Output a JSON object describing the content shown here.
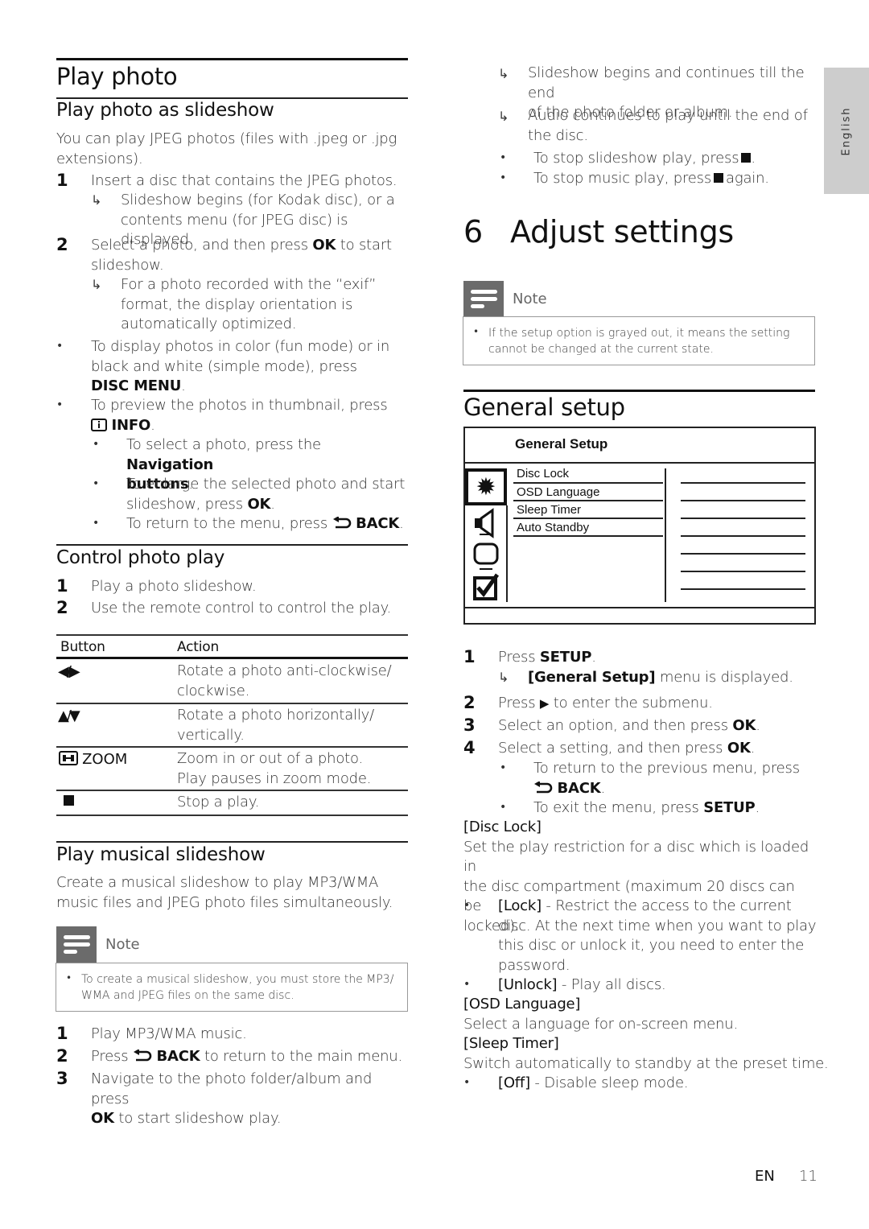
{
  "left": {
    "section_title": "Play photo",
    "slideshow": {
      "title": "Play photo as slideshow",
      "intro": "You can play JPEG photos (files with .jpeg or .jpg extensions).",
      "intro_l1": "You can play JPEG photos (files with .jpeg or .jpg",
      "intro_l2": "extensions).",
      "step1": {
        "num": "1",
        "text": "Insert a disc that contains the JPEG photos.",
        "result_l1": "Slideshow begins (for Kodak disc), or a",
        "result_l2": "contents menu (for JPEG disc) is displayed."
      },
      "step2": {
        "num": "2",
        "l1_pre": "Select a photo, and then press ",
        "l1_bold": "OK",
        "l1_post": " to start",
        "l2": "slideshow.",
        "result_l1": "For a photo recorded with the “exif”",
        "result_l2": "format, the display orientation is",
        "result_l3": "automatically optimized."
      },
      "bullet1": {
        "l1": "To display photos in color (fun mode) or in",
        "l2": "black and white (simple mode), press",
        "bold": "DISC MENU",
        "post": "."
      },
      "bullet2": {
        "l1": "To preview the photos in thumbnail, press",
        "bold": "INFO",
        "post": "."
      },
      "sub1": {
        "pre": "To select a photo, press the ",
        "bold1": "Navigation",
        "bold2": "buttons",
        "post": "."
      },
      "sub2": {
        "l1": "To enlarge the selected photo and start",
        "l2_pre": "slideshow, press ",
        "bold": "OK",
        "post": "."
      },
      "sub3": {
        "pre": "To return to the menu, press ",
        "bold": "BACK",
        "post": "."
      }
    },
    "control": {
      "title": "Control photo play",
      "step1": {
        "num": "1",
        "text": "Play a photo slideshow."
      },
      "step2": {
        "num": "2",
        "text": "Use the remote control to control the play."
      },
      "table": {
        "headers": [
          "Button",
          "Action"
        ],
        "rows": [
          {
            "button": "◀/▶",
            "icon": "left-right-arrows-icon",
            "action_l1": "Rotate a photo anti-clockwise/",
            "action_l2": "clockwise."
          },
          {
            "button": "▲/▼",
            "icon": "up-down-arrows-icon",
            "action_l1": "Rotate a photo horizontally/",
            "action_l2": "vertically."
          },
          {
            "button": "ZOOM",
            "icon": "zoom-icon",
            "action_l1": "Zoom in or out of a photo.",
            "action_l2": "Play pauses in zoom mode."
          },
          {
            "button": "■",
            "icon": "stop-icon",
            "action_l1": "Stop a play.",
            "action_l2": ""
          }
        ]
      }
    },
    "musical": {
      "title": "Play musical slideshow",
      "intro_l1": "Create a musical slideshow to play MP3/WMA",
      "intro_l2": "music files and JPEG photo files simultaneously.",
      "note": {
        "label": "Note",
        "l1": "To create a musical slideshow, you must store the MP3/",
        "l2": "WMA and JPEG files on the same disc."
      },
      "step1": {
        "num": "1",
        "text": "Play MP3/WMA music."
      },
      "step2": {
        "num": "2",
        "pre": "Press ",
        "bold": "BACK",
        "post": " to return to the main menu."
      },
      "step3": {
        "num": "3",
        "l1": "Navigate to the photo folder/album and press",
        "bold": "OK",
        "l2_post": " to start slideshow play."
      }
    }
  },
  "right": {
    "continued": {
      "r1_l1": "Slideshow begins and continues till the end",
      "r1_l2": "of the photo folder or album.",
      "r2_l1": "Audio continues to play until the end of",
      "r2_l2": "the disc.",
      "b1_pre": "To stop slideshow play, press",
      "b1_post": ".",
      "b2_pre": "To stop music play, press",
      "b2_post": "again."
    },
    "chapter": {
      "num": "6",
      "title": "Adjust settings"
    },
    "note": {
      "label": "Note",
      "l1": "If the setup option is grayed out, it means the setting",
      "l2": "cannot be changed at the current state."
    },
    "general": {
      "title": "General setup",
      "menu": {
        "title": "General Setup",
        "items": [
          "Disc Lock",
          "OSD Language",
          "Sleep Timer",
          "Auto Standby"
        ],
        "side_icons": [
          "gear-icon",
          "speaker-icon",
          "video-icon",
          "checkbox-icon"
        ],
        "selected_icon": "gear-icon"
      },
      "step1": {
        "num": "1",
        "pre": "Press ",
        "bold": "SETUP",
        "post": ".",
        "result_bold": "[General Setup]",
        "result_post": " menu is displayed."
      },
      "step2": {
        "num": "2",
        "pre": "Press ",
        "post": " to enter the submenu."
      },
      "step3": {
        "num": "3",
        "pre": "Select an option, and then press ",
        "bold": "OK",
        "post": "."
      },
      "step4": {
        "num": "4",
        "pre": "Select a setting, and then press ",
        "bold": "OK",
        "post": "."
      },
      "sub1": {
        "l1": "To return to the previous menu, press",
        "bold": "BACK",
        "post": "."
      },
      "sub2": {
        "pre": "To exit the menu, press ",
        "bold": "SETUP",
        "post": "."
      },
      "disc_lock": {
        "heading": "[Disc Lock]",
        "l1": "Set the play restriction for a disc which is loaded in",
        "l2": "the disc compartment (maximum 20 discs can be",
        "l3": "locked).",
        "lock_bold": "[Lock]",
        "lock_l1": " - Restrict the access to the current",
        "lock_l2": "disc. At the next time when you want to play",
        "lock_l3": "this disc or unlock it, you need to enter the",
        "lock_l4": "password.",
        "unlock_bold": "[Unlock]",
        "unlock_text": " - Play all discs."
      },
      "osd": {
        "heading": "[OSD Language]",
        "text": "Select a language for on-screen menu."
      },
      "sleep": {
        "heading": "[Sleep Timer]",
        "text": "Switch automatically to standby at the preset time.",
        "off_bold": "[Off]",
        "off_text": " - Disable sleep mode."
      }
    }
  },
  "side_tab": "English",
  "footer": {
    "lang": "EN",
    "page": "11"
  }
}
